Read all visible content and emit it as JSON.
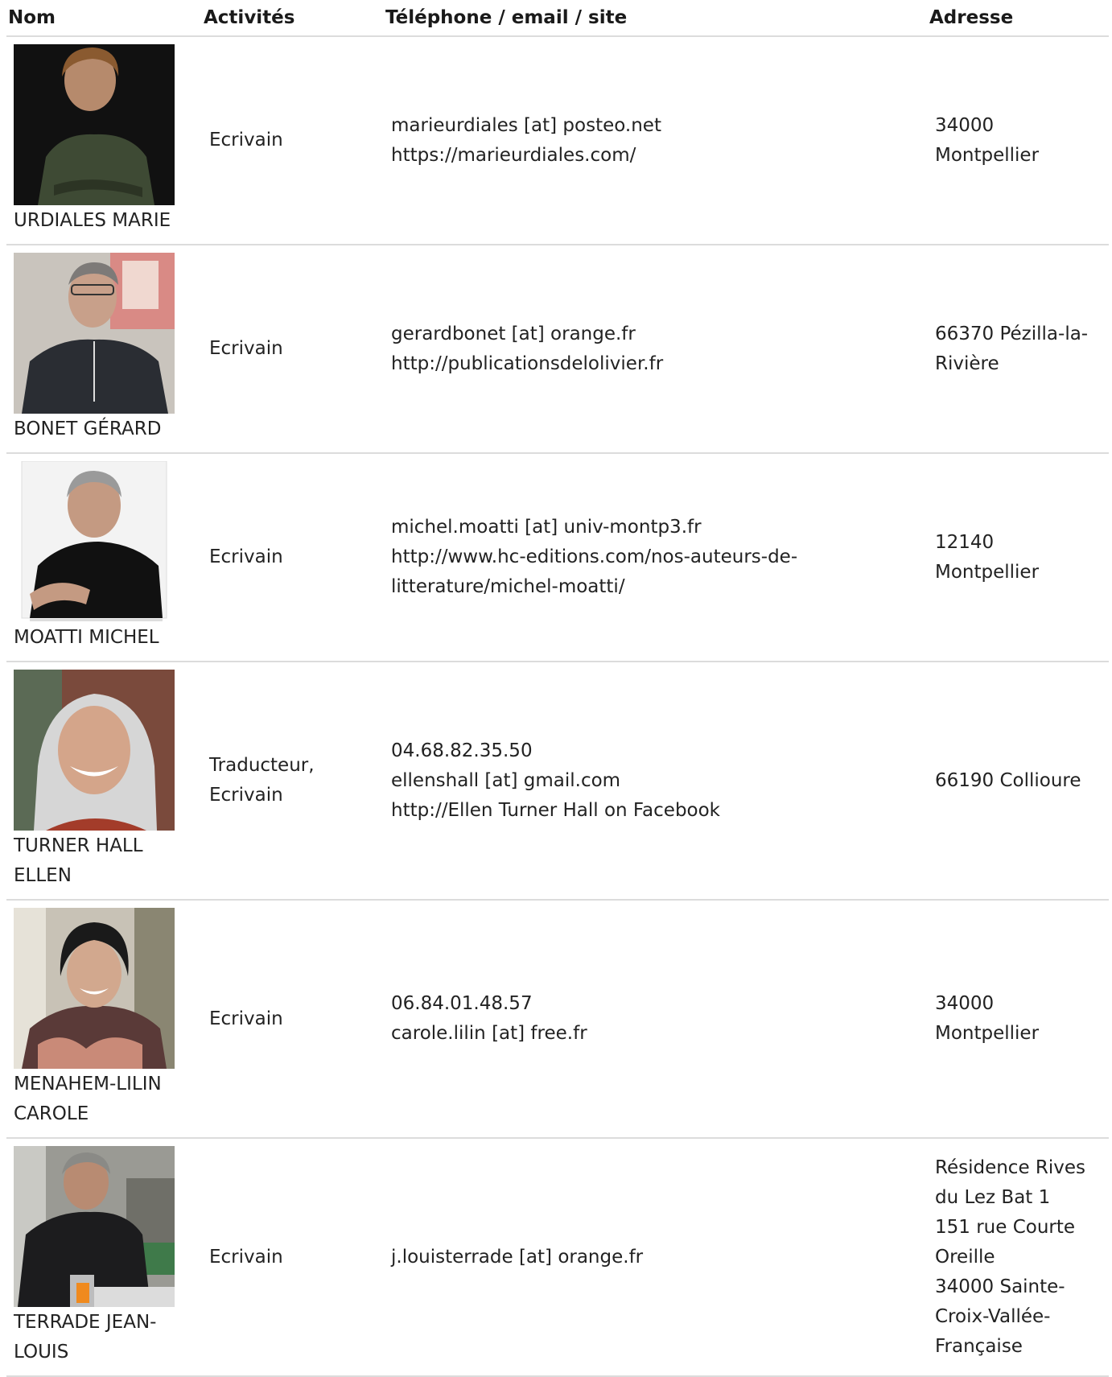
{
  "headers": {
    "nom": "Nom",
    "activites": "Activités",
    "contact": "Téléphone / email / site",
    "adresse": "Adresse"
  },
  "rows": [
    {
      "name": "URDIALES MARIE",
      "activity": "Ecrivain",
      "contact": [
        "marieurdiales [at] posteo.net",
        "https://marieurdiales.com/"
      ],
      "address": [
        "34000",
        "Montpellier"
      ]
    },
    {
      "name": "BONET GÉRARD",
      "activity": "Ecrivain",
      "contact": [
        "gerardbonet [at] orange.fr",
        "http://publicationsdelolivier.fr"
      ],
      "address": [
        "66370 Pézilla-la-",
        "Rivière"
      ]
    },
    {
      "name": "MOATTI MICHEL",
      "activity": "Ecrivain",
      "contact": [
        "michel.moatti [at] univ-montp3.fr",
        "http://www.hc-editions.com/nos-auteurs-de-",
        "litterature/michel-moatti/"
      ],
      "address": [
        "12140",
        "Montpellier"
      ]
    },
    {
      "name": "TURNER HALL ELLEN",
      "activity": "Traducteur, Ecrivain",
      "contact": [
        "04.68.82.35.50",
        "ellenshall [at] gmail.com",
        "http://Ellen Turner Hall on Facebook"
      ],
      "address": [
        "66190 Collioure"
      ]
    },
    {
      "name": "MENAHEM-LILIN CAROLE",
      "activity": "Ecrivain",
      "contact": [
        "06.84.01.48.57",
        "carole.lilin [at] free.fr"
      ],
      "address": [
        "34000",
        "Montpellier"
      ]
    },
    {
      "name": "TERRADE JEAN-LOUIS",
      "activity": "Ecrivain",
      "contact": [
        "j.louisterrade [at] orange.fr"
      ],
      "address": [
        "Résidence Rives",
        "du Lez Bat 1",
        "151 rue Courte",
        "Oreille",
        "34000 Sainte-",
        "Croix-Vallée-",
        "Française"
      ]
    }
  ]
}
